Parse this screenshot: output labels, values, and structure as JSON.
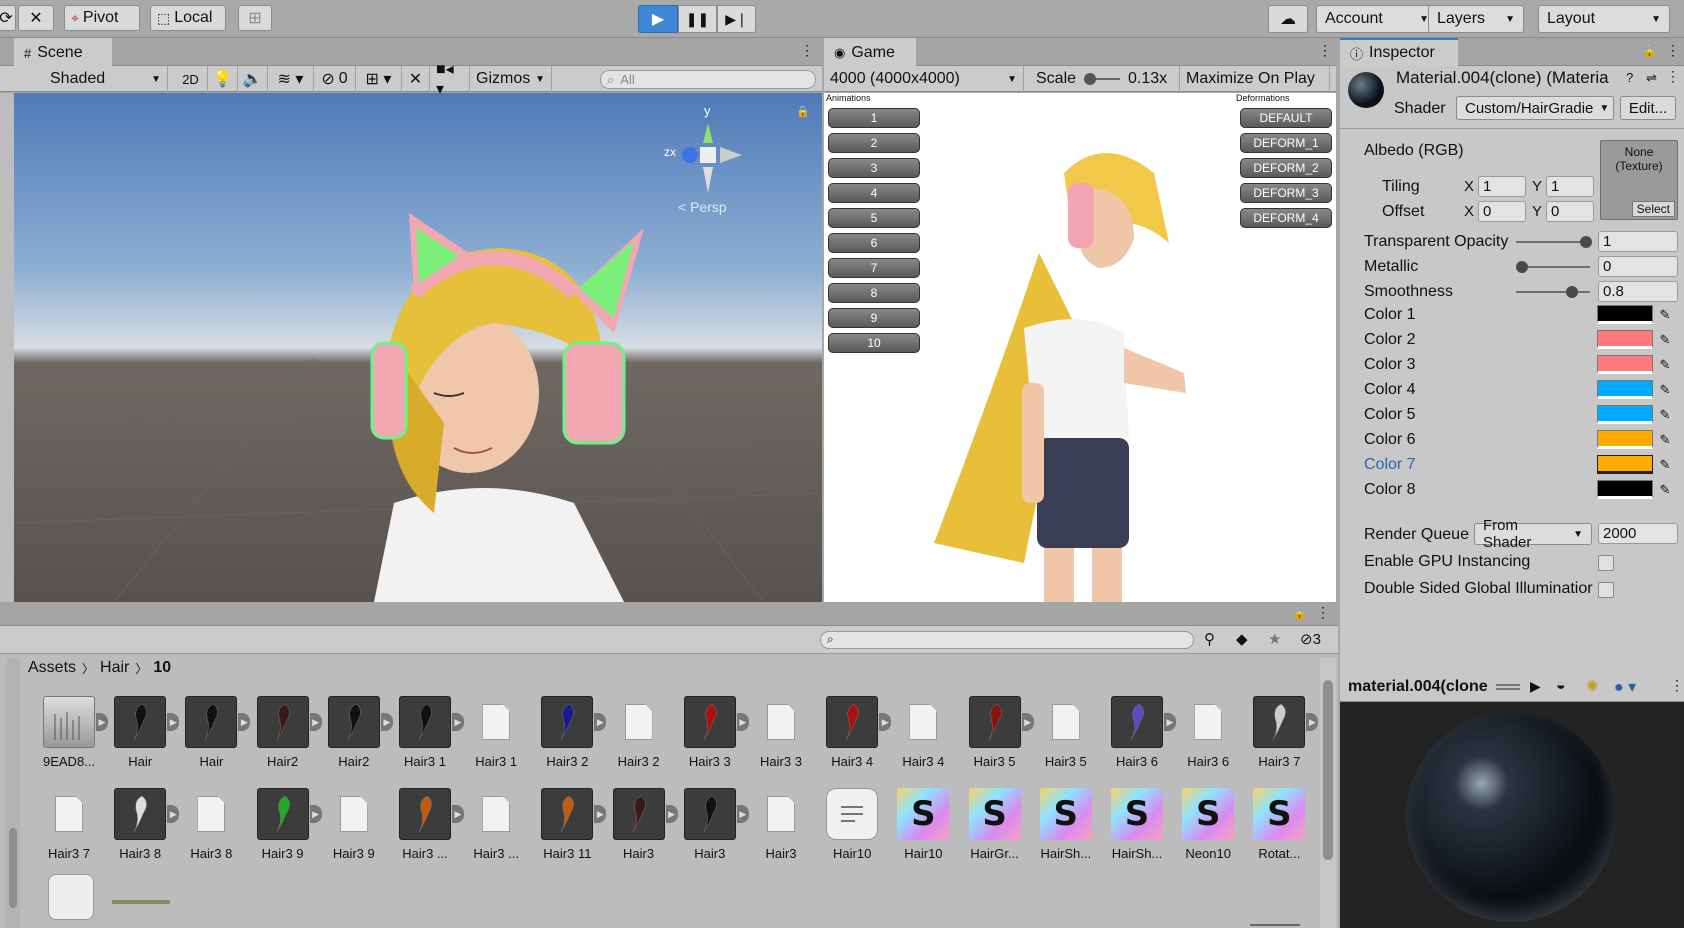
{
  "toolbar": {
    "pivot_label": "Pivot",
    "local_label": "Local",
    "account_label": "Account",
    "layers_label": "Layers",
    "layout_label": "Layout"
  },
  "scene": {
    "tab_label": "Scene",
    "shading_mode": "Shaded",
    "mode_2d": "2D",
    "hidden_count": "0",
    "gizmos_label": "Gizmos",
    "search_placeholder": "All",
    "persp_label": "< Persp",
    "axis_y": "y",
    "axis_zx": "zx"
  },
  "game": {
    "tab_label": "Game",
    "resolution": "4000 (4000x4000)",
    "scale_label": "Scale",
    "scale_value": "0.13x",
    "maximize_label": "Maximize On Play",
    "animations_title": "Animations",
    "deformations_title": "Deformations",
    "animations": [
      "1",
      "2",
      "3",
      "4",
      "5",
      "6",
      "7",
      "8",
      "9",
      "10"
    ],
    "deformations": [
      "DEFAULT",
      "DEFORM_1",
      "DEFORM_2",
      "DEFORM_3",
      "DEFORM_4"
    ]
  },
  "inspector": {
    "tab_label": "Inspector",
    "material_name": "Material.004(clone) (Materia",
    "shader_label": "Shader",
    "shader_value": "Custom/HairGradie",
    "edit_label": "Edit...",
    "albedo_label": "Albedo (RGB)",
    "texture_none": "None (Texture)",
    "texture_select": "Select",
    "tiling_label": "Tiling",
    "offset_label": "Offset",
    "x_label": "X",
    "y_label": "Y",
    "tiling_x": "1",
    "tiling_y": "1",
    "offset_x": "0",
    "offset_y": "0",
    "transparent_opacity_label": "Transparent Opacity",
    "transparent_opacity": "1",
    "metallic_label": "Metallic",
    "metallic": "0",
    "smoothness_label": "Smoothness",
    "smoothness": "0.8",
    "colors": [
      {
        "label": "Color 1",
        "hex": "#000000"
      },
      {
        "label": "Color 2",
        "hex": "#ff7a7a"
      },
      {
        "label": "Color 3",
        "hex": "#ff7a7a"
      },
      {
        "label": "Color 4",
        "hex": "#00aaff"
      },
      {
        "label": "Color 5",
        "hex": "#00aaff"
      },
      {
        "label": "Color 6",
        "hex": "#ffaa00"
      },
      {
        "label": "Color 7",
        "hex": "#ffaa00"
      },
      {
        "label": "Color 8",
        "hex": "#000000"
      }
    ],
    "render_queue_label": "Render Queue",
    "render_queue_mode": "From Shader",
    "render_queue_value": "2000",
    "gpu_instancing_label": "Enable GPU Instancing",
    "double_sided_label": "Double Sided Global Illuminatior",
    "preview_title": "material.004(clone"
  },
  "project": {
    "breadcrumb": [
      "Assets",
      "Hair",
      "10"
    ],
    "hidden_count": "3",
    "row1": [
      {
        "label": "9EAD8...",
        "kind": "img"
      },
      {
        "label": "Hair",
        "kind": "hair",
        "color": "#111111"
      },
      {
        "label": "Hair",
        "kind": "hair",
        "color": "#111111"
      },
      {
        "label": "Hair2",
        "kind": "hair",
        "color": "#3a1a14"
      },
      {
        "label": "Hair2",
        "kind": "hair",
        "color": "#111111"
      },
      {
        "label": "Hair3 1",
        "kind": "hair",
        "color": "#111111"
      },
      {
        "label": "Hair3 1",
        "kind": "file"
      },
      {
        "label": "Hair3 2",
        "kind": "hair",
        "color": "#1a1a8a"
      },
      {
        "label": "Hair3 2",
        "kind": "file"
      },
      {
        "label": "Hair3 3",
        "kind": "hair",
        "color": "#aa1111"
      },
      {
        "label": "Hair3 3",
        "kind": "file"
      },
      {
        "label": "Hair3 4",
        "kind": "hair",
        "color": "#aa1111"
      },
      {
        "label": "Hair3 4",
        "kind": "file"
      },
      {
        "label": "Hair3 5",
        "kind": "hair",
        "color": "#881111"
      },
      {
        "label": "Hair3 5",
        "kind": "file"
      },
      {
        "label": "Hair3 6",
        "kind": "hair",
        "color": "#5b4bc0"
      },
      {
        "label": "Hair3 6",
        "kind": "file"
      },
      {
        "label": "Hair3 7",
        "kind": "hair",
        "color": "#cccccc"
      }
    ],
    "row2": [
      {
        "label": "Hair3 7",
        "kind": "file"
      },
      {
        "label": "Hair3 8",
        "kind": "hair",
        "color": "#dddddd"
      },
      {
        "label": "Hair3 8",
        "kind": "file"
      },
      {
        "label": "Hair3 9",
        "kind": "hair",
        "color": "#22aa22"
      },
      {
        "label": "Hair3 9",
        "kind": "file"
      },
      {
        "label": "Hair3 ...",
        "kind": "hair",
        "color": "#c25a10"
      },
      {
        "label": "Hair3 ...",
        "kind": "file"
      },
      {
        "label": "Hair3 11",
        "kind": "hair",
        "color": "#c25a10"
      },
      {
        "label": "Hair3",
        "kind": "hair",
        "color": "#3a1a14"
      },
      {
        "label": "Hair3",
        "kind": "hair",
        "color": "#111111"
      },
      {
        "label": "Hair3",
        "kind": "file"
      },
      {
        "label": "Hair10",
        "kind": "doc"
      },
      {
        "label": "Hair10",
        "kind": "shader"
      },
      {
        "label": "HairGr...",
        "kind": "shader"
      },
      {
        "label": "HairSh...",
        "kind": "shader"
      },
      {
        "label": "HairSh...",
        "kind": "shader"
      },
      {
        "label": "Neon10",
        "kind": "shader"
      },
      {
        "label": "Rotat...",
        "kind": "shader"
      }
    ],
    "shader_glyph": "S"
  }
}
